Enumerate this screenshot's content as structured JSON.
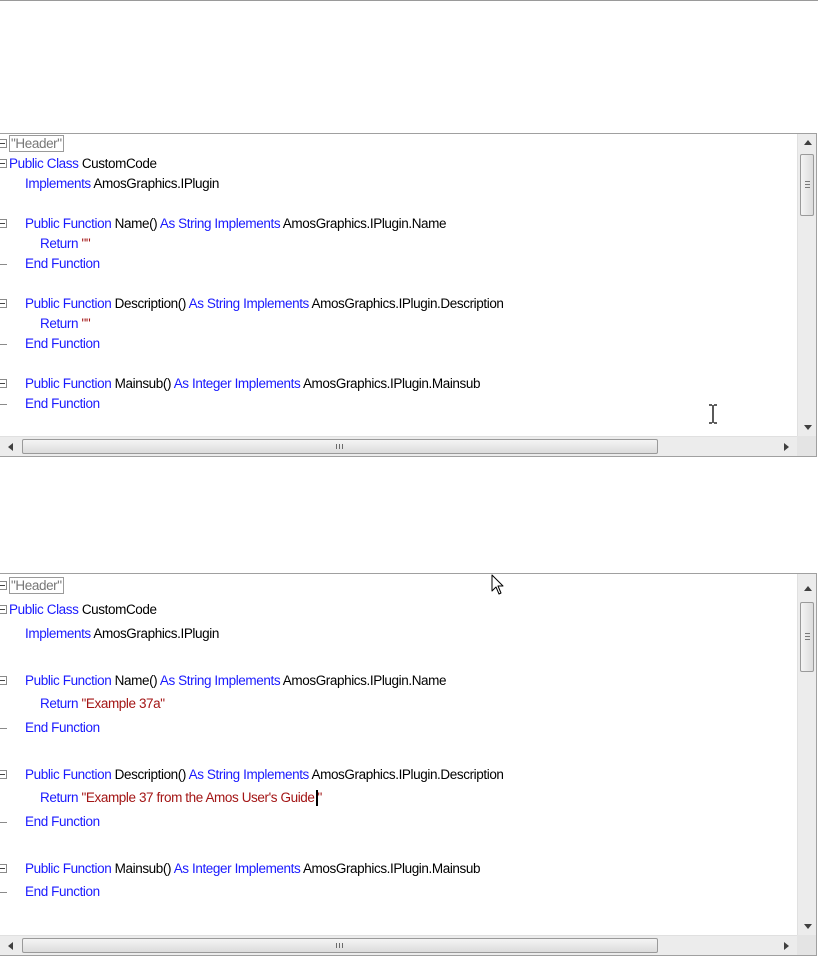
{
  "editors": [
    {
      "lines": [
        [
          {
            "t": "\"Header\"",
            "c": "tag"
          }
        ],
        [
          {
            "t": "Public Class ",
            "c": "kw"
          },
          {
            "t": "CustomCode",
            "c": "id"
          }
        ],
        [
          {
            "t": "Implements ",
            "c": "kw"
          },
          {
            "t": "AmosGraphics.IPlugin",
            "c": "id"
          }
        ],
        [],
        [
          {
            "t": "Public Function ",
            "c": "kw"
          },
          {
            "t": "Name() ",
            "c": "id"
          },
          {
            "t": "As String Implements ",
            "c": "kw"
          },
          {
            "t": "AmosGraphics.IPlugin.Name",
            "c": "id"
          }
        ],
        [
          {
            "t": "Return ",
            "c": "kw"
          },
          {
            "t": "\"\"",
            "c": "str"
          }
        ],
        [
          {
            "t": "End Function",
            "c": "kw"
          }
        ],
        [],
        [
          {
            "t": "Public Function ",
            "c": "kw"
          },
          {
            "t": "Description() ",
            "c": "id"
          },
          {
            "t": "As String Implements ",
            "c": "kw"
          },
          {
            "t": "AmosGraphics.IPlugin.Description",
            "c": "id"
          }
        ],
        [
          {
            "t": "Return ",
            "c": "kw"
          },
          {
            "t": "\"\"",
            "c": "str"
          }
        ],
        [
          {
            "t": "End Function",
            "c": "kw"
          }
        ],
        [],
        [
          {
            "t": "Public Function ",
            "c": "kw"
          },
          {
            "t": "Mainsub() ",
            "c": "id"
          },
          {
            "t": "As Integer Implements ",
            "c": "kw"
          },
          {
            "t": "AmosGraphics.IPlugin.Mainsub",
            "c": "id"
          }
        ],
        [
          {
            "t": "End Function",
            "c": "kw"
          }
        ]
      ]
    },
    {
      "lines": [
        [
          {
            "t": "\"Header\"",
            "c": "tag"
          }
        ],
        [
          {
            "t": "Public Class ",
            "c": "kw"
          },
          {
            "t": "CustomCode",
            "c": "id"
          }
        ],
        [
          {
            "t": "Implements ",
            "c": "kw"
          },
          {
            "t": "AmosGraphics.IPlugin",
            "c": "id"
          }
        ],
        [],
        [
          {
            "t": "Public Function ",
            "c": "kw"
          },
          {
            "t": "Name() ",
            "c": "id"
          },
          {
            "t": "As String Implements ",
            "c": "kw"
          },
          {
            "t": "AmosGraphics.IPlugin.Name",
            "c": "id"
          }
        ],
        [
          {
            "t": "Return ",
            "c": "kw"
          },
          {
            "t": "\"Example 37a\"",
            "c": "str"
          }
        ],
        [
          {
            "t": "End Function",
            "c": "kw"
          }
        ],
        [],
        [
          {
            "t": "Public Function ",
            "c": "kw"
          },
          {
            "t": "Description() ",
            "c": "id"
          },
          {
            "t": "As String Implements ",
            "c": "kw"
          },
          {
            "t": "AmosGraphics.IPlugin.Description",
            "c": "id"
          }
        ],
        [
          {
            "t": "Return ",
            "c": "kw"
          },
          {
            "t": "\"Example 37 from the Amos User's Guide",
            "c": "str"
          },
          {
            "t": "",
            "c": "caret"
          },
          {
            "t": "\"",
            "c": "str"
          }
        ],
        [
          {
            "t": "End Function",
            "c": "kw"
          }
        ],
        [],
        [
          {
            "t": "Public Function ",
            "c": "kw"
          },
          {
            "t": "Mainsub() ",
            "c": "id"
          },
          {
            "t": "As Integer Implements ",
            "c": "kw"
          },
          {
            "t": "AmosGraphics.IPlugin.Mainsub",
            "c": "id"
          }
        ],
        [
          {
            "t": "End Function",
            "c": "kw"
          }
        ]
      ]
    }
  ],
  "scrollbar": {
    "h_grip_label": "III",
    "v_grip_label": "≡"
  },
  "colors": {
    "keyword": "#1a1aff",
    "identifier": "#000000",
    "string": "#a31515",
    "region_tag": "#777777"
  }
}
